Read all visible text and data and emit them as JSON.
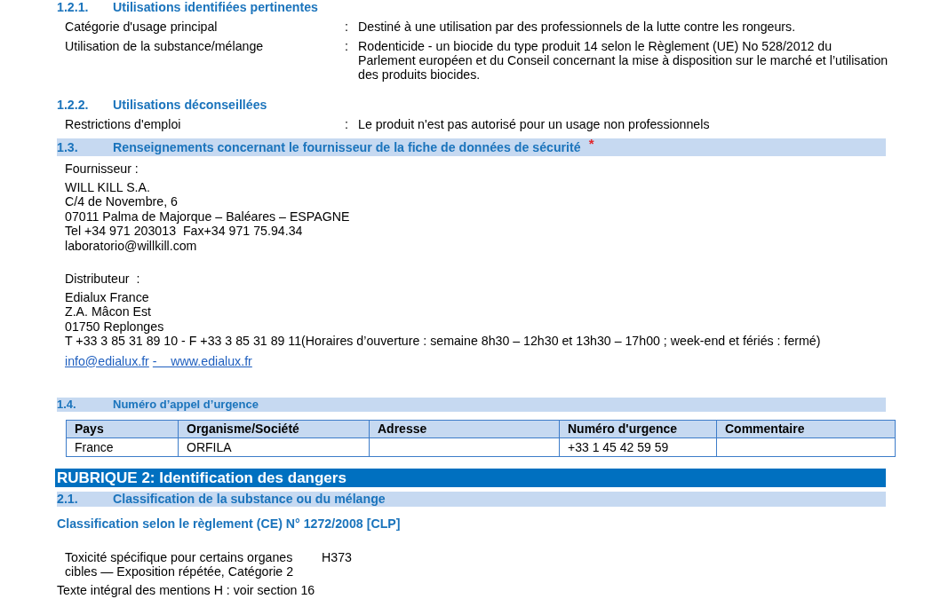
{
  "document": {
    "blocks": [
      {
        "kind": "subheading",
        "number": "1.2.1.",
        "title": "Utilisations identifiées pertinentes"
      },
      {
        "kind": "field",
        "label": "Catégorie d'usage principal",
        "colon": ":",
        "value": "Destiné à une utilisation par des professionnels de la lutte contre les rongeurs."
      },
      {
        "kind": "field",
        "label": "Utilisation de la substance/mélange",
        "colon": ":",
        "value": "Rodenticide - un biocide du type produit 14 selon le Règlement (UE) No 528/2012 du Parlement européen et du Conseil concernant la mise à disposition sur le marché et l’utilisation des produits biocides."
      },
      {
        "kind": "subheading",
        "number": "1.2.2.",
        "title": "Utilisations déconseillées"
      },
      {
        "kind": "field",
        "label": "Restrictions d'emploi",
        "colon": ":",
        "value": "Le produit n'est pas autorisé pour un usage non professionnels"
      },
      {
        "kind": "band",
        "number": "1.3.",
        "title": "Renseignements concernant le fournisseur de la fiche de données de sécurité",
        "asterisk": "*"
      },
      {
        "kind": "label",
        "text": "Fournisseur :"
      },
      {
        "kind": "address",
        "lines": [
          "WILL KILL S.A.",
          "C/4 de Novembre, 6",
          "07011 Palma de Majorque – Baléares – ESPAGNE",
          "Tel +34 971 203013  Fax+34 971 75.94.34",
          "laboratorio@willkill.com"
        ]
      },
      {
        "kind": "label",
        "text": "Distributeur  :"
      },
      {
        "kind": "address",
        "lines": [
          "Edialux France",
          "Z.A. Mâcon Est",
          "01750 Replonges",
          "T +33 3 85 31 89 10 - F +33 3 85 31 89 11(Horaires d’ouverture : semaine 8h30 – 12h30 et 13h30 – 17h00 ; week-end et fériés : fermé)"
        ]
      },
      {
        "kind": "links",
        "email": "info@edialux.fr",
        "website": "-    www.edialux.fr"
      },
      {
        "kind": "band",
        "number": "1.4.",
        "title": "Numéro d’appel d’urgence"
      },
      {
        "kind": "table",
        "columns": [
          "Pays",
          "Organisme/Société",
          "Adresse",
          "Numéro d'urgence",
          "Commentaire"
        ],
        "rows": [
          [
            "France",
            "ORFILA",
            null,
            "+33 1 45 42 59 59",
            null
          ]
        ]
      },
      {
        "kind": "banner",
        "text": "RUBRIQUE 2: Identification des dangers"
      },
      {
        "kind": "band",
        "number": "2.1.",
        "title": "Classification de la substance ou du mélange"
      },
      {
        "kind": "heading",
        "text": "Classification selon le règlement (CE) N° 1272/2008 [CLP]"
      },
      {
        "kind": "classification",
        "label": "Toxicité spécifique pour certains organes cibles — Exposition répétée, Catégorie 2",
        "code": "H373"
      },
      {
        "kind": "note",
        "text": "Texte intégral des mentions H : voir section 16"
      }
    ]
  }
}
